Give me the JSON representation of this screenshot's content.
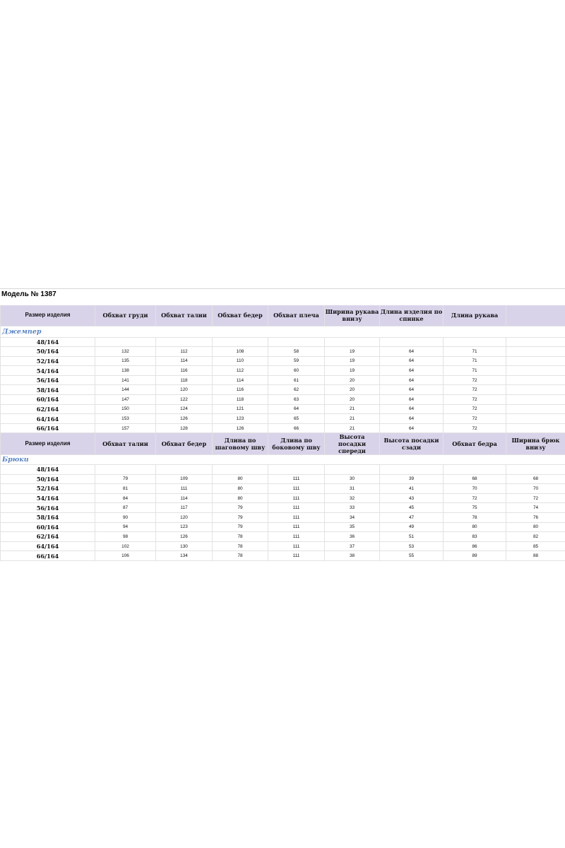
{
  "model_title": "Модель №  1387",
  "jumper": {
    "section_label": "Джемпер",
    "size_header": "Размер изделия",
    "columns": [
      "Обхват груди",
      "Обхват талии",
      "Обхват бедер",
      "Обхват плеча",
      "Ширина рукава внизу",
      "Длина изделия по спинке",
      "Длина рукава",
      ""
    ],
    "rows": [
      {
        "size": "48/164",
        "values": [
          "",
          "",
          "",
          "",
          "",
          "",
          "",
          ""
        ]
      },
      {
        "size": "50/164",
        "values": [
          "132",
          "112",
          "108",
          "58",
          "19",
          "64",
          "71",
          ""
        ]
      },
      {
        "size": "52/164",
        "values": [
          "135",
          "114",
          "110",
          "59",
          "19",
          "64",
          "71",
          ""
        ]
      },
      {
        "size": "54/164",
        "values": [
          "138",
          "116",
          "112",
          "60",
          "19",
          "64",
          "71",
          ""
        ]
      },
      {
        "size": "56/164",
        "values": [
          "141",
          "118",
          "114",
          "61",
          "20",
          "64",
          "72",
          ""
        ]
      },
      {
        "size": "58/164",
        "values": [
          "144",
          "120",
          "116",
          "62",
          "20",
          "64",
          "72",
          ""
        ]
      },
      {
        "size": "60/164",
        "values": [
          "147",
          "122",
          "118",
          "63",
          "20",
          "64",
          "72",
          ""
        ]
      },
      {
        "size": "62/164",
        "values": [
          "150",
          "124",
          "121",
          "64",
          "21",
          "64",
          "72",
          ""
        ]
      },
      {
        "size": "64/164",
        "values": [
          "153",
          "126",
          "123",
          "65",
          "21",
          "64",
          "72",
          ""
        ]
      },
      {
        "size": "66/164",
        "values": [
          "157",
          "128",
          "126",
          "66",
          "21",
          "64",
          "72",
          ""
        ]
      }
    ]
  },
  "trousers": {
    "section_label": "Брюки",
    "size_header": "Размер изделия",
    "columns": [
      "Обхват талии",
      "Обхват бедер",
      "Длина по шаговому шву",
      "Длина по боковому шву",
      "Высота посадки спереди",
      "Высота посадки сзади",
      "Обхват бедра",
      "Ширина брюк внизу"
    ],
    "rows": [
      {
        "size": "48/164",
        "values": [
          "",
          "",
          "",
          "",
          "",
          "",
          "",
          ""
        ]
      },
      {
        "size": "50/164",
        "values": [
          "79",
          "109",
          "80",
          "111",
          "30",
          "39",
          "68",
          "68"
        ]
      },
      {
        "size": "52/164",
        "values": [
          "81",
          "111",
          "80",
          "111",
          "31",
          "41",
          "70",
          "70"
        ]
      },
      {
        "size": "54/164",
        "values": [
          "84",
          "114",
          "80",
          "111",
          "32",
          "43",
          "72",
          "72"
        ]
      },
      {
        "size": "56/164",
        "values": [
          "87",
          "117",
          "79",
          "111",
          "33",
          "45",
          "75",
          "74"
        ]
      },
      {
        "size": "58/164",
        "values": [
          "90",
          "120",
          "79",
          "111",
          "34",
          "47",
          "78",
          "76"
        ]
      },
      {
        "size": "60/164",
        "values": [
          "94",
          "123",
          "79",
          "111",
          "35",
          "49",
          "80",
          "80"
        ]
      },
      {
        "size": "62/164",
        "values": [
          "98",
          "126",
          "78",
          "111",
          "36",
          "51",
          "83",
          "82"
        ]
      },
      {
        "size": "64/164",
        "values": [
          "102",
          "130",
          "78",
          "111",
          "37",
          "53",
          "86",
          "85"
        ]
      },
      {
        "size": "66/164",
        "values": [
          "106",
          "134",
          "78",
          "111",
          "38",
          "55",
          "89",
          "88"
        ]
      }
    ]
  }
}
